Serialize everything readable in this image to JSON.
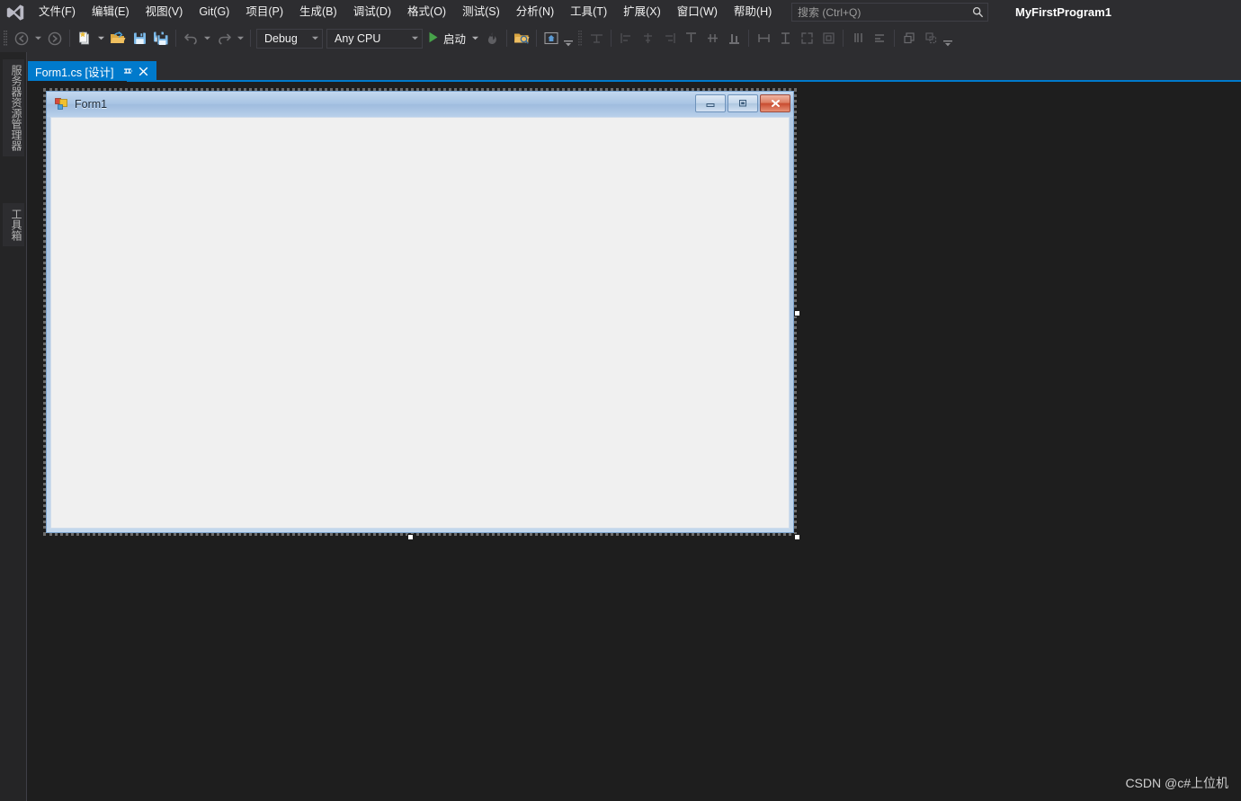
{
  "window": {
    "project_name": "MyFirstProgram1",
    "logo_icon": "visual-studio-logo-icon"
  },
  "menubar": {
    "items": [
      {
        "label": "文件(F)",
        "name": "file"
      },
      {
        "label": "编辑(E)",
        "name": "edit"
      },
      {
        "label": "视图(V)",
        "name": "view"
      },
      {
        "label": "Git(G)",
        "name": "git"
      },
      {
        "label": "项目(P)",
        "name": "project"
      },
      {
        "label": "生成(B)",
        "name": "build"
      },
      {
        "label": "调试(D)",
        "name": "debug"
      },
      {
        "label": "格式(O)",
        "name": "format"
      },
      {
        "label": "测试(S)",
        "name": "test"
      },
      {
        "label": "分析(N)",
        "name": "analyze"
      },
      {
        "label": "工具(T)",
        "name": "tools"
      },
      {
        "label": "扩展(X)",
        "name": "extensions"
      },
      {
        "label": "窗口(W)",
        "name": "window"
      },
      {
        "label": "帮助(H)",
        "name": "help"
      }
    ]
  },
  "search": {
    "placeholder": "搜索 (Ctrl+Q)",
    "value": "",
    "icon": "search-icon"
  },
  "toolbar": {
    "navigate_back_icon": "navigate-back-icon",
    "navigate_forward_icon": "navigate-forward-icon",
    "new_item_icon": "new-item-icon",
    "open_file_icon": "open-file-icon",
    "save_icon": "save-icon",
    "save_all_icon": "save-all-icon",
    "undo_icon": "undo-icon",
    "redo_icon": "redo-icon",
    "config": {
      "value": "Debug",
      "label": "Debug"
    },
    "platform": {
      "value": "Any CPU",
      "label": "Any CPU"
    },
    "run": {
      "label": "启动",
      "icon": "play-icon"
    },
    "hot_reload_icon": "hot-reload-icon",
    "live_share_icon": "live-share-icon",
    "preview_icon": "preview-icon",
    "overflow_label": "⌄",
    "layout_icons": [
      "tab-order-icon",
      "align-lefts-icon",
      "align-centers-icon",
      "align-rights-icon",
      "align-tops-icon",
      "align-middles-icon",
      "align-bottoms-icon",
      "make-same-width-icon",
      "make-same-height-icon",
      "size-to-grid-icon",
      "center-horizontally-icon",
      "horizontal-spacing-icon",
      "vertical-spacing-icon",
      "bring-to-front-icon",
      "send-to-back-icon"
    ]
  },
  "left_dock": {
    "tabs": [
      {
        "label": "服务器资源管理器",
        "name": "server-explorer"
      },
      {
        "label": "工具箱",
        "name": "toolbox"
      }
    ]
  },
  "document_tab": {
    "label": "Form1.cs [设计]",
    "pin_icon": "pin-icon",
    "close_icon": "close-icon",
    "active_color": "#007acc"
  },
  "designer": {
    "form": {
      "title": "Form1",
      "icon": "winforms-form-icon",
      "minimize_icon": "minimize-icon",
      "maximize_icon": "maximize-icon",
      "close_icon": "close-x-icon",
      "client_background": "#f0f0f0",
      "selected": true
    },
    "handles": [
      "right-middle",
      "bottom-center",
      "bottom-right"
    ]
  },
  "watermark": {
    "text": "CSDN @c#上位机"
  },
  "colors": {
    "chrome": "#2d2d30",
    "canvas": "#1e1e1e",
    "accent": "#007acc",
    "text": "#f1f1f1"
  }
}
